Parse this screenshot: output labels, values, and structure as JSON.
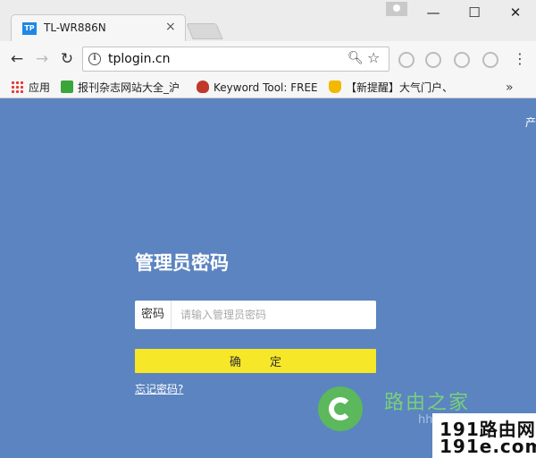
{
  "browser": {
    "tab_title": "TL-WR886N",
    "tab_favicon": "TP",
    "url": "tplogin.cn",
    "window_controls": {
      "minimize": "—",
      "maximize": "☐",
      "close": "✕"
    },
    "nav": {
      "back": "←",
      "forward": "→",
      "reload": "↻"
    },
    "bookmarks": [
      {
        "label": "应用",
        "icon": "apps-grid-icon"
      },
      {
        "label": "报刊杂志网站大全_沪",
        "icon": "green-c-icon"
      },
      {
        "label": "Keyword Tool: FREE",
        "icon": "flame-icon"
      },
      {
        "label": "【新提醒】大气门户、",
        "icon": "trophy-icon"
      }
    ],
    "bookmarks_more": "»"
  },
  "page": {
    "corner_text": "产",
    "title": "管理员密码",
    "password_label": "密码",
    "password_placeholder": "请输入管理员密码",
    "password_value": "",
    "confirm_label": "确 定",
    "forgot_link": "忘记密码?"
  },
  "watermark": {
    "cn_text": "路由之家",
    "url": "hh",
    "box_line1": "191路由网",
    "box_line2": "191e.com"
  },
  "colors": {
    "page_bg": "#5b84c0",
    "confirm_button": "#f6e728",
    "chrome_bg": "#f6f6f6"
  }
}
